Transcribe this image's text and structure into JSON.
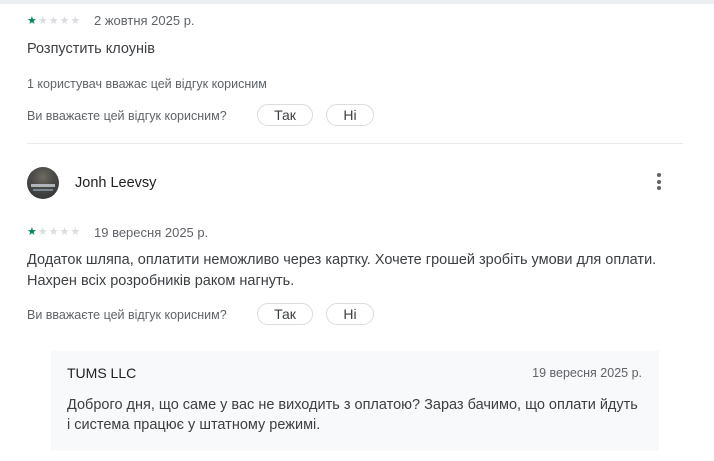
{
  "review1": {
    "rating": 1,
    "max_rating": 5,
    "date": "2 жовтня 2025 р.",
    "text": "Розпустить клоунів",
    "helpful_count_text": "1 користувач вважає цей відгук корисним",
    "helpful_question": "Ви вважаєте цей відгук корисним?",
    "yes_label": "Так",
    "no_label": "Ні"
  },
  "review2": {
    "author": "Jonh Leevsy",
    "more_icon": "more-vert-icon",
    "rating": 1,
    "max_rating": 5,
    "date": "19 вересня 2025 р.",
    "text_line1": "Додаток шляпа, оплатити неможливо через картку. Хочете грошей зробіть умови для оплати.",
    "text_line2": "Нахрен всіх розробників раком нагнуть.",
    "helpful_question": "Ви вважаєте цей відгук корисним?",
    "yes_label": "Так",
    "no_label": "Ні",
    "reply": {
      "developer": "TUMS LLC",
      "date": "19 вересня 2025 р.",
      "text_line1": "Доброго дня, що саме у вас не виходить з оплатою? Зараз бачимо, що оплати йдуть",
      "text_line2": "і система працює у штатному режимі."
    }
  },
  "colors": {
    "star_filled": "#01875f",
    "star_empty": "#dadce0",
    "reply_bg": "#f8f9fa"
  }
}
